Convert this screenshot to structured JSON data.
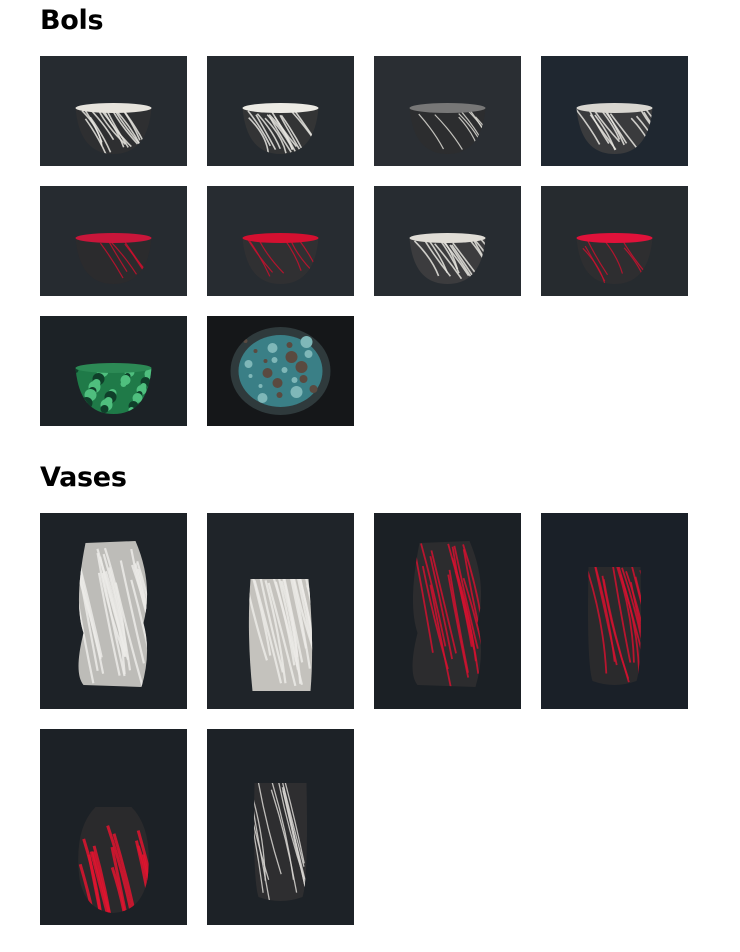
{
  "sections": {
    "bowls": {
      "title": "Bols",
      "items": [
        {
          "kind": "bowl",
          "rim": "#e6e3dc",
          "body": "#2e2f31",
          "glaze": "white-crackle",
          "bg": "#262b30"
        },
        {
          "kind": "bowl",
          "rim": "#eceae4",
          "body": "#333435",
          "glaze": "white-crackle",
          "bg": "#252a2f"
        },
        {
          "kind": "bowl",
          "rim": "#777777",
          "body": "#2c2d2f",
          "glaze": "white-lines",
          "bg": "#2a2e33"
        },
        {
          "kind": "bowl",
          "rim": "#d8d6d0",
          "body": "#3a3b3d",
          "glaze": "white-crackle",
          "bg": "#1f2730"
        },
        {
          "kind": "bowl",
          "rim": "#c8163a",
          "body": "#2b2b2d",
          "glaze": "red-lines",
          "bg": "#262b30"
        },
        {
          "kind": "bowl",
          "rim": "#d41030",
          "body": "#303032",
          "glaze": "red-lines",
          "bg": "#272c31"
        },
        {
          "kind": "bowl",
          "rim": "#e0ddd6",
          "body": "#3c3c3e",
          "glaze": "white-crackle",
          "bg": "#272c31"
        },
        {
          "kind": "bowl",
          "rim": "#e0123a",
          "body": "#2e2e30",
          "glaze": "red-lines",
          "bg": "#262b2f"
        },
        {
          "kind": "bowl",
          "rim": "#2c8a55",
          "body": "#1f7a48",
          "glaze": "green-mottled",
          "bg": "#1c2226"
        },
        {
          "kind": "bowl-top",
          "rim": "#3a7f86",
          "body": "#2f3a3c",
          "glaze": "turquoise",
          "bg": "#151719"
        }
      ]
    },
    "vases": {
      "title": "Vases",
      "items": [
        {
          "kind": "vase-twist",
          "body": "#bdbcb8",
          "glaze": "white-crackle",
          "bg": "#1d2227"
        },
        {
          "kind": "vase-square",
          "body": "#c4c2bd",
          "glaze": "white-crackle",
          "bg": "#1f2429"
        },
        {
          "kind": "vase-twist",
          "body": "#2c2c2e",
          "glaze": "red-lines",
          "bg": "#1b2025"
        },
        {
          "kind": "vase-tall",
          "body": "#2a2a2c",
          "glaze": "red-lines",
          "bg": "#1a2028"
        },
        {
          "kind": "vase-oval",
          "body": "#2a2a2c",
          "glaze": "red-patch",
          "bg": "#1c2126"
        },
        {
          "kind": "vase-tall",
          "body": "#2e2e30",
          "glaze": "white-lines",
          "bg": "#1d2227"
        }
      ]
    }
  }
}
